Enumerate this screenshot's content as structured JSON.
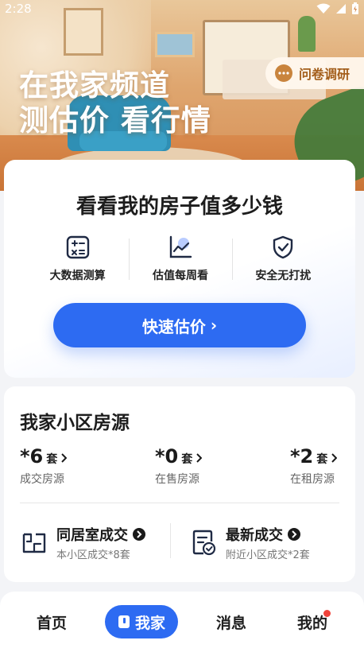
{
  "status_bar": {
    "time": "2:28"
  },
  "hero": {
    "title_line1": "在我家频道",
    "title_line2": "测估价 看行情",
    "survey_button": "问卷调研"
  },
  "valuation": {
    "title": "看看我的房子值多少钱",
    "features": [
      {
        "label": "大数据测算",
        "icon": "calculator-icon"
      },
      {
        "label": "估值每周看",
        "icon": "trend-chart-icon"
      },
      {
        "label": "安全无打扰",
        "icon": "shield-check-icon"
      }
    ],
    "cta": "快速估价",
    "cta_arrow": "›"
  },
  "community": {
    "title": "我家小区房源",
    "stats": [
      {
        "num": "*6",
        "unit": "套",
        "caption": "成交房源"
      },
      {
        "num": "*0",
        "unit": "套",
        "caption": "在售房源"
      },
      {
        "num": "*2",
        "unit": "套",
        "caption": "在租房源"
      }
    ],
    "links": [
      {
        "title": "同居室成交",
        "subtitle": "本小区成交*8套",
        "icon": "floorplan-icon"
      },
      {
        "title": "最新成交",
        "subtitle": "附近小区成交*2套",
        "icon": "document-check-icon"
      }
    ]
  },
  "bottom_nav": {
    "items": [
      {
        "label": "首页"
      },
      {
        "label": "我家",
        "active": true
      },
      {
        "label": "消息"
      },
      {
        "label": "我的",
        "badge_dot": true
      }
    ]
  },
  "colors": {
    "accent": "#2d6bf2",
    "survey_text": "#a35e1b",
    "badge": "#f0433a"
  }
}
